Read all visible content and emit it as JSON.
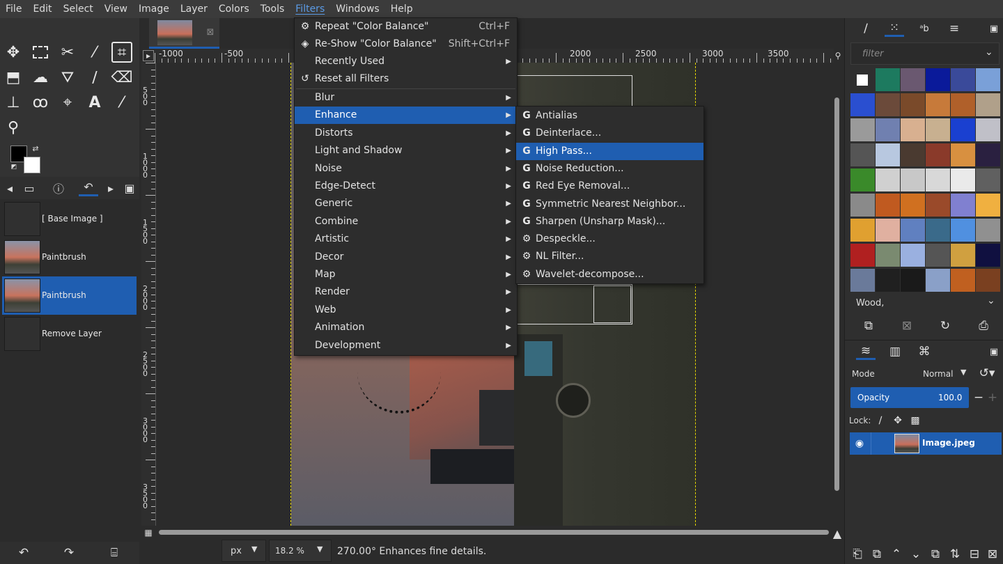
{
  "menubar": [
    "File",
    "Edit",
    "Select",
    "View",
    "Image",
    "Layer",
    "Colors",
    "Tools",
    "Filters",
    "Windows",
    "Help"
  ],
  "menubar_active": "Filters",
  "filters_menu": {
    "repeat_label": "Repeat \"Color Balance\"",
    "repeat_shortcut": "Ctrl+F",
    "reshow_label": "Re-Show \"Color Balance\"",
    "reshow_shortcut": "Shift+Ctrl+F",
    "recently_used": "Recently Used",
    "reset_all": "Reset all Filters",
    "submenus": [
      "Blur",
      "Enhance",
      "Distorts",
      "Light and Shadow",
      "Noise",
      "Edge-Detect",
      "Generic",
      "Combine",
      "Artistic",
      "Decor",
      "Map",
      "Render",
      "Web",
      "Animation",
      "Development"
    ],
    "highlighted": "Enhance"
  },
  "enhance_menu": {
    "items": [
      {
        "label": "Antialias",
        "icon": "gegl-icon"
      },
      {
        "label": "Deinterlace...",
        "icon": "gegl-icon"
      },
      {
        "label": "High Pass...",
        "icon": "gegl-icon"
      },
      {
        "label": "Noise Reduction...",
        "icon": "gegl-icon"
      },
      {
        "label": "Red Eye Removal...",
        "icon": "gegl-icon"
      },
      {
        "label": "Symmetric Nearest Neighbor...",
        "icon": "gegl-icon"
      },
      {
        "label": "Sharpen (Unsharp Mask)...",
        "icon": "gegl-icon"
      },
      {
        "label": "Despeckle...",
        "icon": "script-gear-icon"
      },
      {
        "label": "NL Filter...",
        "icon": "script-gear-icon"
      },
      {
        "label": "Wavelet-decompose...",
        "icon": "script-gear-icon"
      }
    ],
    "highlighted": "High Pass..."
  },
  "undo_history": [
    {
      "label": "[ Base Image ]",
      "selected": false
    },
    {
      "label": "Paintbrush",
      "selected": false
    },
    {
      "label": "Paintbrush",
      "selected": true
    },
    {
      "label": "Remove Layer",
      "selected": false
    }
  ],
  "ruler_top_labels": [
    "-1000",
    "-500",
    "2000",
    "2500",
    "3000",
    "3500"
  ],
  "ruler_left_labels": [
    "500",
    "1000",
    "1500",
    "2000",
    "2500",
    "3000",
    "3500"
  ],
  "status": {
    "unit": "px",
    "zoom": "18.2 %",
    "message": "270.00° Enhances fine details."
  },
  "patterns": {
    "filter_placeholder": "filter",
    "selected_name": "Wood,"
  },
  "layers": {
    "mode_label": "Mode",
    "mode_value": "Normal",
    "opacity_label": "Opacity",
    "opacity_value": "100.0",
    "lock_label": "Lock:",
    "layer_name": "Image.jpeg"
  },
  "colors": {
    "accent": "#1f5eb1",
    "menu_bg": "#2d2d2d",
    "fg_color": "#000000",
    "bg_color": "#ffffff"
  }
}
